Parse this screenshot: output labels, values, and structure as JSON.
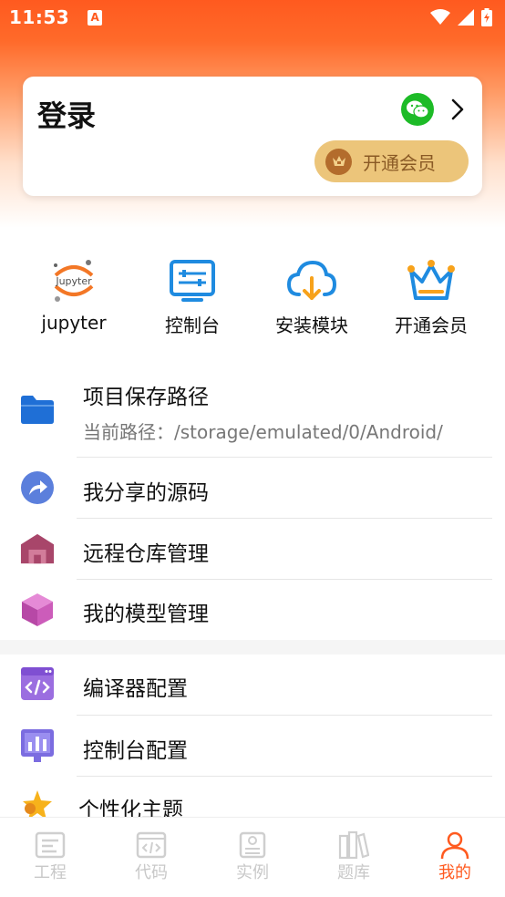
{
  "status_bar": {
    "time": "11:53",
    "notif_letter": "A"
  },
  "login_card": {
    "title": "登录",
    "vip_button_label": "开通会员",
    "colors": {
      "wechat": "#1dbb27",
      "vip_bg": "#ecc57a",
      "vip_text": "#8a5a25"
    }
  },
  "shortcuts": [
    {
      "label": "jupyter",
      "icon": "jupyter-logo-icon",
      "logo_text": "Jupyter"
    },
    {
      "label": "控制台",
      "icon": "console-icon"
    },
    {
      "label": "安装模块",
      "icon": "cloud-download-icon"
    },
    {
      "label": "开通会员",
      "icon": "crown-icon"
    }
  ],
  "menu": {
    "group1": [
      {
        "title": "项目保存路径",
        "subtitle": "当前路径：/storage/emulated/0/Android/",
        "icon": "folder-icon"
      },
      {
        "title": "我分享的源码",
        "icon": "share-icon"
      },
      {
        "title": "远程仓库管理",
        "icon": "warehouse-icon"
      },
      {
        "title": "我的模型管理",
        "icon": "cube-icon"
      }
    ],
    "group2": [
      {
        "title": "编译器配置",
        "icon": "code-window-icon"
      },
      {
        "title": "控制台配置",
        "icon": "chart-monitor-icon"
      },
      {
        "title": "个性化主题",
        "icon": "theme-star-icon"
      }
    ]
  },
  "bottom_nav": [
    {
      "label": "工程",
      "icon": "project-icon",
      "active": false
    },
    {
      "label": "代码",
      "icon": "code-icon",
      "active": false
    },
    {
      "label": "实例",
      "icon": "example-icon",
      "active": false
    },
    {
      "label": "题库",
      "icon": "books-icon",
      "active": false
    },
    {
      "label": "我的",
      "icon": "person-icon",
      "active": true
    }
  ],
  "colors": {
    "accent": "#ff5a1f",
    "inactive_nav": "#c8c8c8"
  }
}
